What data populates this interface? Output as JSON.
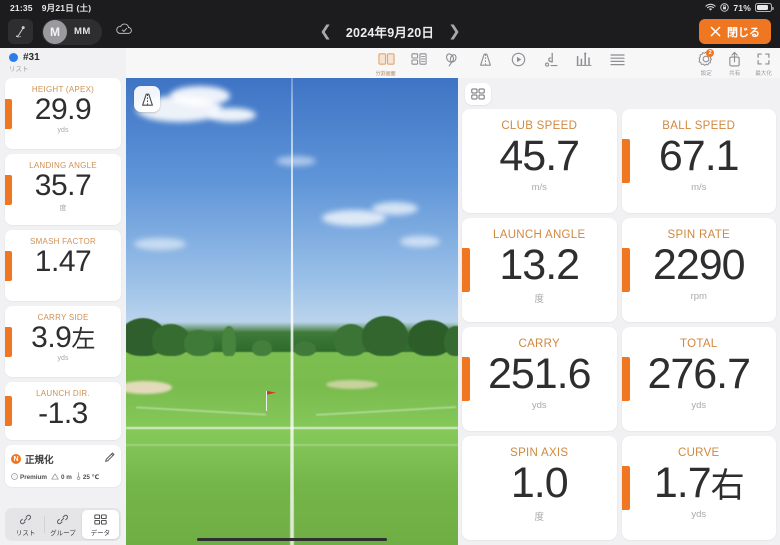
{
  "statusbar": {
    "time": "21:35",
    "date": "9月21日 (土)",
    "battery_pct": "71%",
    "wifi_icon": "wifi-icon",
    "lock_icon": "rotation-lock-icon",
    "battery_icon": "battery-icon"
  },
  "topbar": {
    "session_icon": "golf-swing-icon",
    "avatar_initial": "M",
    "avatar_name": "MM",
    "cloud_icon": "cloud-sync-icon",
    "prev_icon": "chevron-left-icon",
    "next_icon": "chevron-right-icon",
    "date": "2024年9月20日",
    "close_label": "閉じる",
    "close_icon": "close-x-icon"
  },
  "toolbar": {
    "center_tools": [
      {
        "icon": "split-screen-icon",
        "caption": "分割画面",
        "active": true
      },
      {
        "icon": "tiles-layout-icon",
        "caption": "",
        "active": false
      },
      {
        "icon": "swing-analysis-icon",
        "caption": "",
        "active": false
      },
      {
        "icon": "trajectory-icon",
        "caption": "",
        "active": false
      },
      {
        "icon": "play-circle-icon",
        "caption": "",
        "active": false
      },
      {
        "icon": "club-path-icon",
        "caption": "",
        "active": false
      },
      {
        "icon": "bar-chart-icon",
        "caption": "",
        "active": false
      },
      {
        "icon": "list-icon",
        "caption": "",
        "active": false
      }
    ],
    "right_tools": [
      {
        "icon": "gear-icon",
        "caption": "設定",
        "badge": "2"
      },
      {
        "icon": "share-icon",
        "caption": "共有",
        "badge": ""
      },
      {
        "icon": "maximize-icon",
        "caption": "最大化",
        "badge": ""
      }
    ]
  },
  "left_panel": {
    "shot_id": "#31",
    "list_caption": "リスト",
    "metrics": [
      {
        "title": "HEIGHT (APEX)",
        "value": "29.9",
        "suffix": "",
        "unit": "yds"
      },
      {
        "title": "LANDING ANGLE",
        "value": "35.7",
        "suffix": "",
        "unit": "度"
      },
      {
        "title": "SMASH FACTOR",
        "value": "1.47",
        "suffix": "",
        "unit": ""
      },
      {
        "title": "CARRY SIDE",
        "value": "3.9",
        "suffix": "左",
        "unit": "yds"
      },
      {
        "title": "LAUNCH DIR.",
        "value": "-1.3",
        "suffix": "",
        "unit": ""
      }
    ],
    "normalize": {
      "badge": "N",
      "label": "正規化",
      "edit_icon": "pencil-icon",
      "ball_icon": "golf-ball-icon",
      "ball": "Premium",
      "altitude_icon": "altitude-icon",
      "altitude": "0 m",
      "temp_icon": "thermometer-icon",
      "temp": "25 ℃"
    },
    "segments": [
      {
        "icon": "list-chain-icon",
        "label": "リスト",
        "selected": false
      },
      {
        "icon": "group-chain-icon",
        "label": "グループ",
        "selected": false
      },
      {
        "icon": "data-grid-icon",
        "label": "データ",
        "selected": true
      }
    ]
  },
  "video": {
    "overlay_button_icon": "trajectory-view-icon",
    "scrubber_name": "video-scrubber"
  },
  "right_panel": {
    "layout_button_icon": "grid-layout-icon",
    "metrics": [
      {
        "title": "CLUB SPEED",
        "value": "45.7",
        "suffix": "",
        "unit": "m/s",
        "tab": false
      },
      {
        "title": "BALL SPEED",
        "value": "67.1",
        "suffix": "",
        "unit": "m/s",
        "tab": true
      },
      {
        "title": "LAUNCH ANGLE",
        "value": "13.2",
        "suffix": "",
        "unit": "度",
        "tab": true
      },
      {
        "title": "SPIN RATE",
        "value": "2290",
        "suffix": "",
        "unit": "rpm",
        "tab": true
      },
      {
        "title": "CARRY",
        "value": "251.6",
        "suffix": "",
        "unit": "yds",
        "tab": true
      },
      {
        "title": "TOTAL",
        "value": "276.7",
        "suffix": "",
        "unit": "yds",
        "tab": true
      },
      {
        "title": "SPIN AXIS",
        "value": "1.0",
        "suffix": "",
        "unit": "度",
        "tab": false
      },
      {
        "title": "CURVE",
        "value": "1.7",
        "suffix": "右",
        "unit": "yds",
        "tab": true
      }
    ]
  },
  "colors": {
    "accent_orange": "#ef7722",
    "title_orange": "#d0883f",
    "shot_dot_blue": "#2b7de9",
    "dark_chrome": "#1c1c1e",
    "page_bg": "#f1f1f3"
  }
}
